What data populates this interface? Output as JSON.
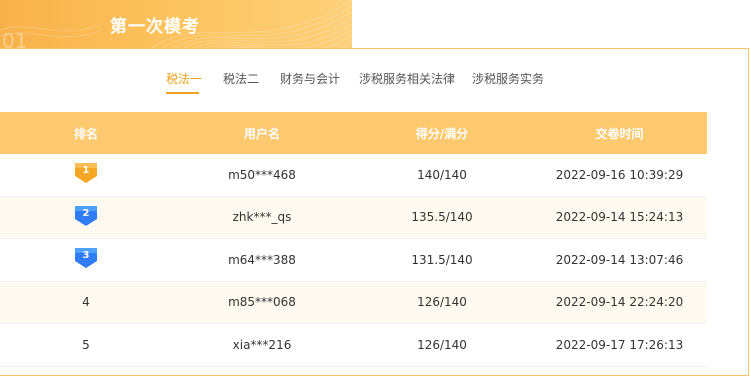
{
  "header": {
    "title": "第一次模考",
    "bg_color": "#fcc25c"
  },
  "tabs": [
    {
      "label": "税法一",
      "active": true
    },
    {
      "label": "税法二",
      "active": false
    },
    {
      "label": "财务与会计",
      "active": false
    },
    {
      "label": "涉税服务相关法律",
      "active": false
    },
    {
      "label": "涉税服务实务",
      "active": false
    }
  ],
  "table": {
    "headers": [
      "排名",
      "用户名",
      "得分/满分",
      "交卷时间"
    ],
    "rows": [
      {
        "rank": "1",
        "medal": "gold",
        "user": "m50***468",
        "score": "140/140",
        "time": "2022-09-16 10:39:29"
      },
      {
        "rank": "2",
        "medal": "blue",
        "user": "zhk***_qs",
        "score": "135.5/140",
        "time": "2022-09-14 15:24:13"
      },
      {
        "rank": "3",
        "medal": "blue",
        "user": "m64***388",
        "score": "131.5/140",
        "time": "2022-09-14 13:07:46"
      },
      {
        "rank": "4",
        "medal": "",
        "user": "m85***068",
        "score": "126/140",
        "time": "2022-09-14 22:24:20"
      },
      {
        "rank": "5",
        "medal": "",
        "user": "xia***216",
        "score": "126/140",
        "time": "2022-09-17 17:26:13"
      }
    ]
  },
  "colors": {
    "accent": "#f0a21d",
    "header_row": "#fdc96f",
    "alt_row": "#fffaf0",
    "medal_gold": "#f5a623",
    "medal_blue": "#2f7cf6"
  }
}
